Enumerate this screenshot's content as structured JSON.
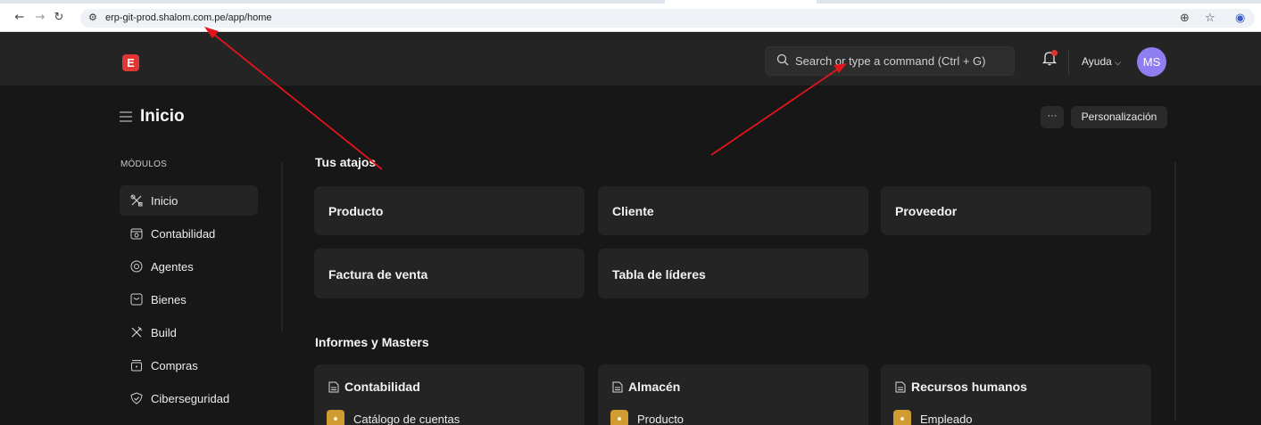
{
  "browser": {
    "url": "erp-git-prod.shalom.com.pe/app/home",
    "back_icon": "arrow-left-icon",
    "forward_icon": "arrow-right-icon",
    "reload_icon": "reload-icon",
    "site_info_icon": "site-settings-icon",
    "zoom_icon": "zoom-icon",
    "bookmark_icon": "star-icon",
    "profile_icon": "profile-icon"
  },
  "navbar": {
    "logo_letter": "E",
    "search_placeholder": "Search or type a command (Ctrl + G)",
    "help_label": "Ayuda",
    "avatar_initials": "MS"
  },
  "page": {
    "title": "Inicio",
    "more_label": "···",
    "customize_label": "Personalización"
  },
  "sidebar": {
    "section_label": "MÓDULOS",
    "items": [
      {
        "label": "Inicio",
        "icon": "tools-icon",
        "active": true
      },
      {
        "label": "Contabilidad",
        "icon": "accounting-icon"
      },
      {
        "label": "Agentes",
        "icon": "agents-icon"
      },
      {
        "label": "Bienes",
        "icon": "assets-icon"
      },
      {
        "label": "Build",
        "icon": "build-icon"
      },
      {
        "label": "Compras",
        "icon": "purchases-icon"
      },
      {
        "label": "Ciberseguridad",
        "icon": "shield-icon"
      }
    ]
  },
  "shortcuts": {
    "title": "Tus atajos",
    "items": [
      {
        "label": "Producto"
      },
      {
        "label": "Cliente"
      },
      {
        "label": "Proveedor"
      },
      {
        "label": "Factura de venta"
      },
      {
        "label": "Tabla de líderes"
      }
    ]
  },
  "reports": {
    "title": "Informes y Masters",
    "cards": [
      {
        "title": "Contabilidad",
        "first_link": "Catálogo de cuentas"
      },
      {
        "title": "Almacén",
        "first_link": "Producto"
      },
      {
        "title": "Recursos humanos",
        "first_link": "Empleado"
      }
    ]
  },
  "colors": {
    "accent_logo": "#e03636",
    "avatar": "#8e7ef2",
    "link_badge": "#d09b31",
    "annotation_arrow": "#e3141c"
  }
}
